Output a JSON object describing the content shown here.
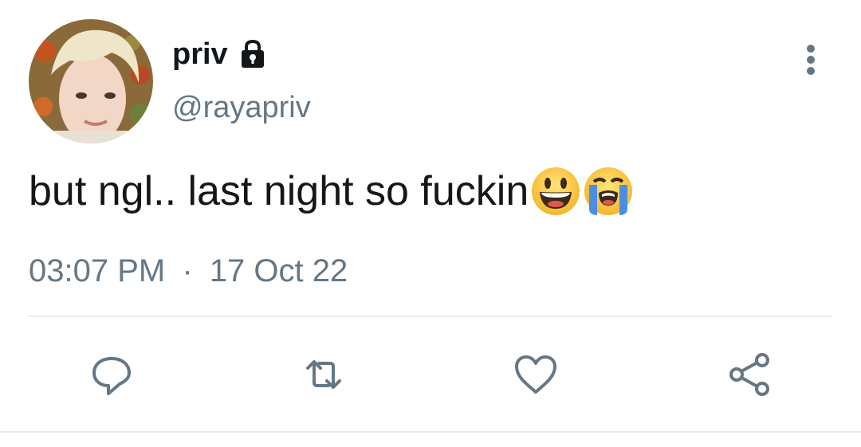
{
  "user": {
    "display_name": "priv",
    "handle": "@rayapriv",
    "avatar_icon": "avatar-photo",
    "locked_icon": "lock-icon"
  },
  "tweet": {
    "text": "but ngl.. last night so fuckin",
    "emojis": [
      "grinning-face-emoji",
      "loudly-crying-face-emoji"
    ]
  },
  "meta": {
    "time": "03:07 PM",
    "separator": "·",
    "date": "17 Oct 22"
  },
  "actions": {
    "reply_icon": "reply-icon",
    "retweet_icon": "retweet-icon",
    "like_icon": "heart-icon",
    "share_icon": "share-icon",
    "more_icon": "more-vertical-icon"
  },
  "colors": {
    "text_primary": "#14171a",
    "text_secondary": "#657786",
    "divider": "#e6ecf0",
    "icon": "#657786"
  }
}
